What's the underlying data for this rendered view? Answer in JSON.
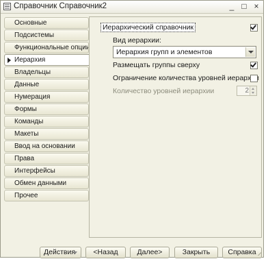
{
  "window": {
    "title": "Справочник Справочник2",
    "controls": {
      "minimize": "_",
      "maximize": "□",
      "close": "×"
    }
  },
  "sidebar": {
    "items": [
      {
        "label": "Основные",
        "active": false
      },
      {
        "label": "Подсистемы",
        "active": false
      },
      {
        "label": "Функциональные опции",
        "active": false
      },
      {
        "label": "Иерархия",
        "active": true
      },
      {
        "label": "Владельцы",
        "active": false
      },
      {
        "label": "Данные",
        "active": false
      },
      {
        "label": "Нумерация",
        "active": false
      },
      {
        "label": "Формы",
        "active": false
      },
      {
        "label": "Команды",
        "active": false
      },
      {
        "label": "Макеты",
        "active": false
      },
      {
        "label": "Ввод на основании",
        "active": false
      },
      {
        "label": "Права",
        "active": false
      },
      {
        "label": "Интерфейсы",
        "active": false
      },
      {
        "label": "Обмен данными",
        "active": false
      },
      {
        "label": "Прочее",
        "active": false
      }
    ]
  },
  "hierarchy": {
    "hierarchical_label": "Иерархический справочник",
    "hierarchical_checked": true,
    "kind_label": "Вид иерархии:",
    "kind_value": "Иерархия групп и элементов",
    "groups_top_label": "Размещать группы сверху",
    "groups_top_checked": true,
    "limit_levels_label": "Ограничение количества уровней иерархии",
    "limit_levels_checked": false,
    "levels_count_label": "Количество уровней иерархии",
    "levels_count_value": "2"
  },
  "buttons": {
    "actions": "Действия",
    "back": "<Назад",
    "next": "Далее>",
    "close": "Закрыть",
    "help": "Справка"
  }
}
